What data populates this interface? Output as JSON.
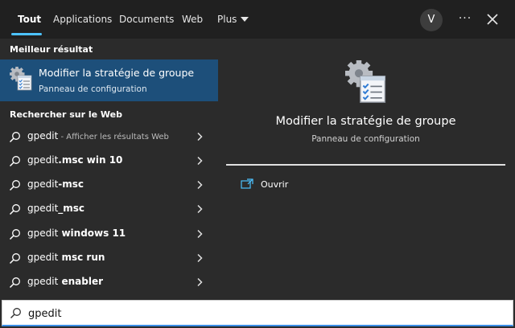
{
  "tabs": [
    {
      "label": "Tout",
      "active": true
    },
    {
      "label": "Applications"
    },
    {
      "label": "Documents"
    },
    {
      "label": "Web"
    },
    {
      "label": "Plus"
    }
  ],
  "user": {
    "initial": "V"
  },
  "more_label": "···",
  "sections": {
    "best": "Meilleur résultat",
    "web": "Rechercher sur le Web"
  },
  "best_match": {
    "title": "Modifier la stratégie de groupe",
    "subtitle": "Panneau de configuration",
    "icon": "group-policy-icon"
  },
  "web_results": [
    {
      "prefix": "gpedit",
      "bold": "",
      "hint": " - Afficher les résultats Web"
    },
    {
      "prefix": "gpedit",
      "bold": ".msc win 10",
      "hint": ""
    },
    {
      "prefix": "gpedit",
      "bold": "-msc",
      "hint": ""
    },
    {
      "prefix": "gpedit",
      "bold": "_msc",
      "hint": ""
    },
    {
      "prefix": "gpedit",
      "bold": " windows 11",
      "hint": ""
    },
    {
      "prefix": "gpedit",
      "bold": " msc run",
      "hint": ""
    },
    {
      "prefix": "gpedit",
      "bold": " enabler",
      "hint": ""
    }
  ],
  "preview": {
    "title": "Modifier la stratégie de groupe",
    "subtitle": "Panneau de configuration",
    "actions": [
      {
        "label": "Ouvrir",
        "icon": "open-icon"
      }
    ]
  },
  "search": {
    "value": "gpedit"
  },
  "colors": {
    "accent": "#4cc2ff",
    "selected": "#1d4f7a",
    "panel": "#2b2b2b",
    "topbar": "#202020"
  }
}
